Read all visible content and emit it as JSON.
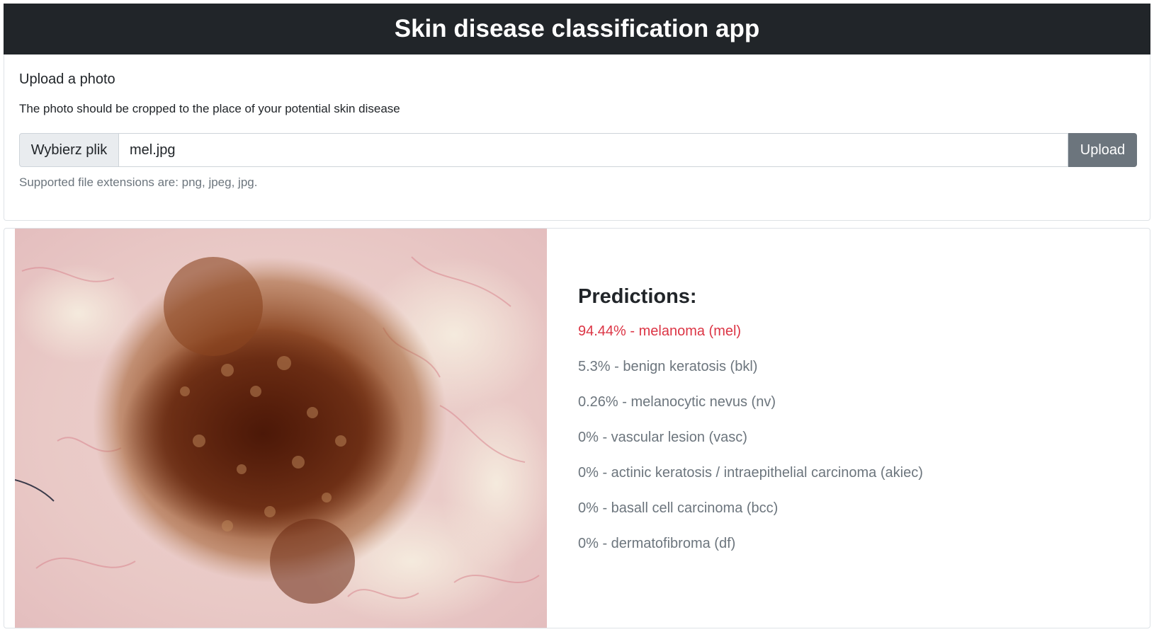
{
  "header": {
    "title": "Skin disease classification app"
  },
  "upload": {
    "title": "Upload a photo",
    "description": "The photo should be cropped to the place of your potential skin disease",
    "choose_button_label": "Wybierz plik",
    "file_name": "mel.jpg",
    "upload_button_label": "Upload",
    "help_text": "Supported file extensions are: png, jpeg, jpg."
  },
  "results": {
    "title": "Predictions:",
    "predictions": [
      "94.44% - melanoma (mel)",
      "5.3% - benign keratosis (bkl)",
      "0.26% - melanocytic nevus (nv)",
      "0% - vascular lesion (vasc)",
      "0% - actinic keratosis / intraepithelial carcinoma (akiec)",
      "0% - basall cell carcinoma (bcc)",
      "0% - dermatofibroma (df)"
    ]
  },
  "colors": {
    "header_bg": "#212529",
    "top_prediction": "#dc3545",
    "other_prediction": "#6c757d",
    "button_secondary": "#6c757d"
  }
}
